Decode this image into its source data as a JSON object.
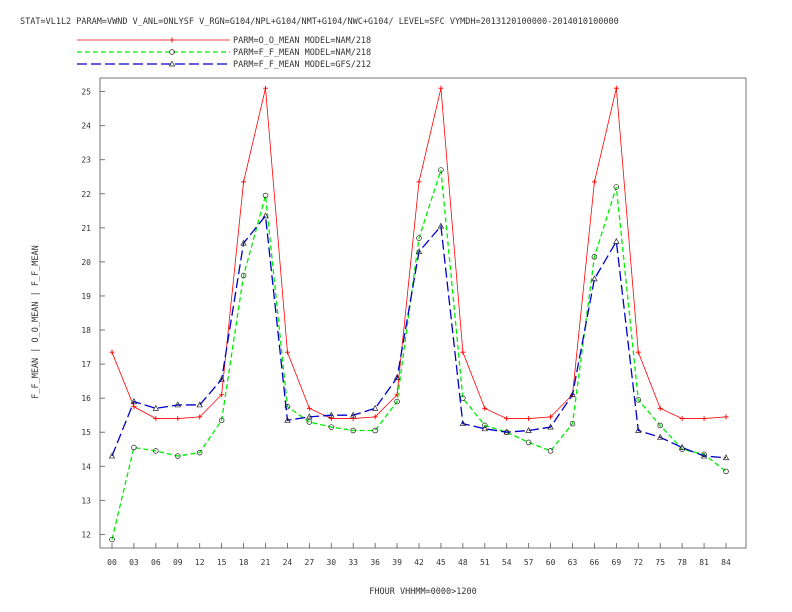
{
  "chart_data": {
    "type": "line",
    "title": "STAT=VL1L2 PARAM=VWND V_ANL=ONLYSF V_RGN=G104/NPL+G104/NMT+G104/NWC+G104/ LEVEL=SFC VYMDH=2013120100000-2014010100000",
    "xlabel": "FHOUR VHHMM=0000>1200",
    "ylabel": "F_F_MEAN | O_O_MEAN | F_F_MEAN",
    "categories": [
      "00",
      "03",
      "06",
      "09",
      "12",
      "15",
      "18",
      "21",
      "24",
      "27",
      "30",
      "33",
      "36",
      "39",
      "42",
      "45",
      "48",
      "51",
      "54",
      "57",
      "60",
      "63",
      "66",
      "69",
      "72",
      "75",
      "78",
      "81",
      "84"
    ],
    "ylim": [
      11.6,
      25.4
    ],
    "yticks": [
      12,
      13,
      14,
      15,
      16,
      17,
      18,
      19,
      20,
      21,
      22,
      23,
      24,
      25
    ],
    "grid": false,
    "legend_position": "top-center",
    "series": [
      {
        "name": "PARM=O_O_MEAN MODEL=NAM/218",
        "color": "#ff0000",
        "dash": "solid",
        "marker": "plus",
        "values": [
          17.35,
          15.75,
          15.4,
          15.4,
          15.45,
          16.1,
          22.35,
          25.1,
          17.35,
          15.7,
          15.4,
          15.4,
          15.45,
          16.1,
          22.35,
          25.1,
          17.35,
          15.7,
          15.4,
          15.4,
          15.45,
          16.1,
          22.35,
          25.1,
          17.35,
          15.7,
          15.4,
          15.4,
          15.45
        ]
      },
      {
        "name": "PARM=F_F_MEAN MODEL=NAM/218",
        "color": "#00ee00",
        "dash": "dashed",
        "marker": "circle",
        "values": [
          11.85,
          14.55,
          14.45,
          14.3,
          14.4,
          15.35,
          19.6,
          21.95,
          15.75,
          15.3,
          15.15,
          15.05,
          15.05,
          15.9,
          20.7,
          22.7,
          16.0,
          15.2,
          15.0,
          14.7,
          14.45,
          15.25,
          20.15,
          22.2,
          15.95,
          15.2,
          14.5,
          14.35,
          13.85
        ]
      },
      {
        "name": "PARM=F_F_MEAN MODEL=GFS/212",
        "color": "#0000cc",
        "dash": "longdash",
        "marker": "triangle",
        "values": [
          14.3,
          15.9,
          15.7,
          15.8,
          15.8,
          16.55,
          20.55,
          21.35,
          15.35,
          15.45,
          15.5,
          15.5,
          15.7,
          16.6,
          20.3,
          21.05,
          15.25,
          15.1,
          15.0,
          15.05,
          15.15,
          16.1,
          19.5,
          20.6,
          15.05,
          14.85,
          14.55,
          14.3,
          14.25
        ]
      }
    ]
  }
}
